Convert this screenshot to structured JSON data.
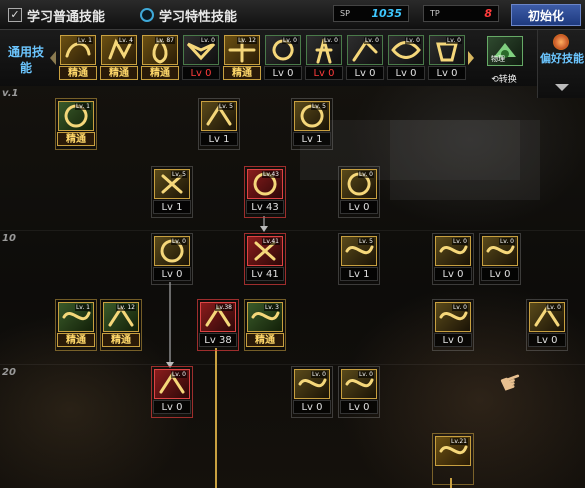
{
  "header": {
    "tab_normal": "学习普通技能",
    "tab_special": "学习特性技能",
    "sp_label": "SP",
    "sp_value": "1035",
    "tp_label": "TP",
    "tp_value": "8",
    "init_button": "初始化"
  },
  "quickbar": {
    "common_label": "通用技能",
    "swap_label": "转换",
    "swap_tag": "物理",
    "preferred_label": "偏好技能",
    "items": [
      {
        "level": "精通",
        "tag": "Lv. 1",
        "icon": "swirl-kick-icon",
        "color": "gold"
      },
      {
        "level": "精通",
        "tag": "Lv. 4",
        "icon": "grab-icon",
        "color": "gold"
      },
      {
        "level": "精通",
        "tag": "Lv. 87",
        "icon": "flame-icon",
        "color": "gold"
      },
      {
        "level": "Lv 0",
        "tag": "Lv. 0",
        "icon": "wing-emblem-icon",
        "color": "red"
      },
      {
        "level": "精通",
        "tag": "Lv. 12",
        "icon": "crosshair-icon",
        "color": "gold"
      },
      {
        "level": "Lv 0",
        "tag": "Lv. 0",
        "icon": "target-icon",
        "color": "white"
      },
      {
        "level": "Lv 0",
        "tag": "Lv. 0",
        "icon": "spirit-figure-icon",
        "color": "red"
      },
      {
        "level": "Lv 0",
        "tag": "Lv. 0",
        "icon": "charge-figure-icon",
        "color": "white"
      },
      {
        "level": "Lv 0",
        "tag": "Lv. 0",
        "icon": "eye-icon",
        "color": "white"
      },
      {
        "level": "Lv 0",
        "tag": "Lv. 0",
        "icon": "muscle-icon",
        "color": "white"
      }
    ]
  },
  "rows": {
    "r1": "1",
    "r10": "10",
    "r20": "20"
  },
  "skills": [
    {
      "id": "s1",
      "level": "精通",
      "tag": "Lv. 1",
      "icon": "rifle-grip-icon",
      "kind": "mastery"
    },
    {
      "id": "s2",
      "level": "Lv 1",
      "tag": "Lv. 5",
      "icon": "swirl-slash-icon",
      "kind": "plain"
    },
    {
      "id": "s3",
      "level": "Lv 1",
      "tag": "Lv. 5",
      "icon": "dash-punch-icon",
      "kind": "plain"
    },
    {
      "id": "s4",
      "level": "Lv 1",
      "tag": "Lv. 5",
      "icon": "burst-icon",
      "kind": "plain"
    },
    {
      "id": "s5",
      "level": "Lv 43",
      "tag": "Lv.43",
      "icon": "cannon-icon",
      "kind": "red"
    },
    {
      "id": "s6",
      "level": "Lv 0",
      "tag": "Lv. 0",
      "icon": "bullet-icon",
      "kind": "plain"
    },
    {
      "id": "s7",
      "level": "Lv 0",
      "tag": "Lv. 0",
      "icon": "claw-slash-icon",
      "kind": "plain"
    },
    {
      "id": "s8",
      "level": "Lv 41",
      "tag": "Lv.41",
      "icon": "flame-gun-icon",
      "kind": "red"
    },
    {
      "id": "s9",
      "level": "Lv 1",
      "tag": "Lv. 5",
      "icon": "lightning-strike-icon",
      "kind": "plain"
    },
    {
      "id": "s10",
      "level": "Lv 0",
      "tag": "Lv. 0",
      "icon": "boot-icon",
      "kind": "plain"
    },
    {
      "id": "s11",
      "level": "Lv 0",
      "tag": "Lv. 0",
      "icon": "fighter-pose-icon",
      "kind": "plain"
    },
    {
      "id": "s12",
      "level": "精通",
      "tag": "Lv. 1",
      "icon": "launcher-icon",
      "kind": "mastery"
    },
    {
      "id": "s13",
      "level": "精通",
      "tag": "Lv. 12",
      "icon": "hand-cannon-icon",
      "kind": "mastery"
    },
    {
      "id": "s14",
      "level": "Lv 38",
      "tag": "Lv.38",
      "icon": "missile-icon",
      "kind": "red"
    },
    {
      "id": "s15",
      "level": "精通",
      "tag": "Lv. 3",
      "icon": "uppercut-icon",
      "kind": "mastery"
    },
    {
      "id": "s16",
      "level": "Lv 0",
      "tag": "Lv. 0",
      "icon": "kick-icon",
      "kind": "plain"
    },
    {
      "id": "s17",
      "level": "Lv 0",
      "tag": "Lv. 0",
      "icon": "grenade-icon",
      "kind": "plain"
    },
    {
      "id": "s18",
      "level": "Lv 0",
      "tag": "Lv. 0",
      "icon": "spin-strike-icon",
      "kind": "red"
    },
    {
      "id": "s19",
      "level": "Lv 0",
      "tag": "Lv. 0",
      "icon": "tornado-fist-icon",
      "kind": "plain"
    },
    {
      "id": "s20",
      "level": "Lv 0",
      "tag": "Lv. 0",
      "icon": "watchful-eye-icon",
      "kind": "plain"
    },
    {
      "id": "s21",
      "level": "",
      "tag": "Lv.21",
      "icon": "laser-cannon-icon",
      "kind": "gold"
    }
  ],
  "colors": {
    "gold": "#c8a040",
    "red_level": "#ff3c3c",
    "accent_blue": "#6cc6ff"
  }
}
